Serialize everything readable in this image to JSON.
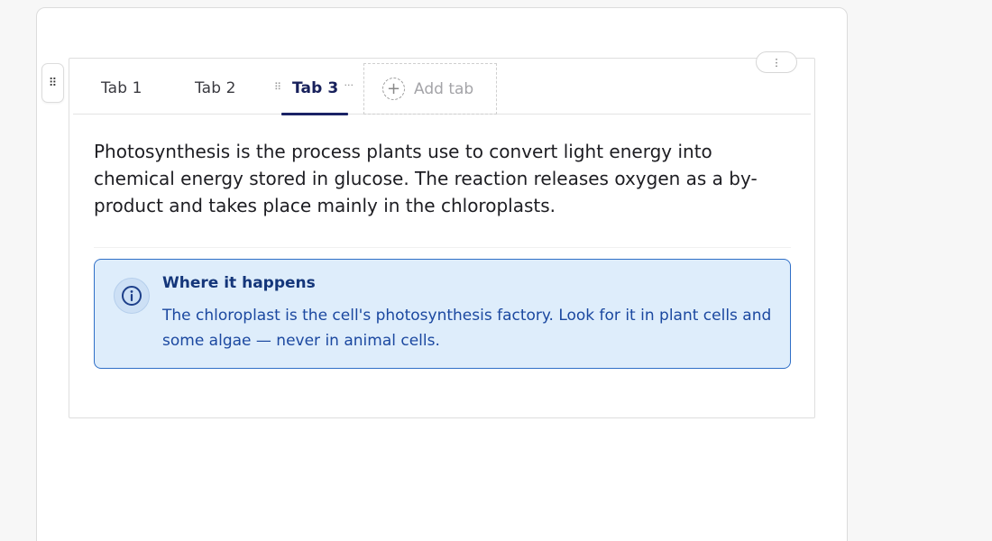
{
  "tabs": [
    {
      "label": "Tab 1",
      "active": false
    },
    {
      "label": "Tab 2",
      "active": false
    },
    {
      "label": "Tab 3",
      "active": true
    }
  ],
  "add_tab": {
    "label": "Add tab",
    "icon": "plus-circle-icon"
  },
  "drag_handle": {
    "icon": "drag-grip-icon",
    "glyph": "⠿"
  },
  "block_menu": {
    "icon": "kebab-menu-icon",
    "glyph": "⋮"
  },
  "tab_grip_glyph": "⠿",
  "tab_more_glyph": "···",
  "content": {
    "paragraph": "Photosynthesis is the process plants use to convert light energy into chemical energy stored in glucose. The reaction releases oxygen as a by-product and takes place mainly in the chloroplasts.",
    "callout": {
      "icon": "info-icon",
      "title": "Where it happens",
      "text": "The chloroplast is the cell's photosynthesis factory. Look for it in plant cells and some algae — never in animal cells."
    }
  },
  "colors": {
    "active_tab": "#17205b",
    "callout_bg": "#deedfb",
    "callout_border": "#2f6fc7",
    "callout_title": "#14367a",
    "callout_text": "#1b48a0"
  }
}
